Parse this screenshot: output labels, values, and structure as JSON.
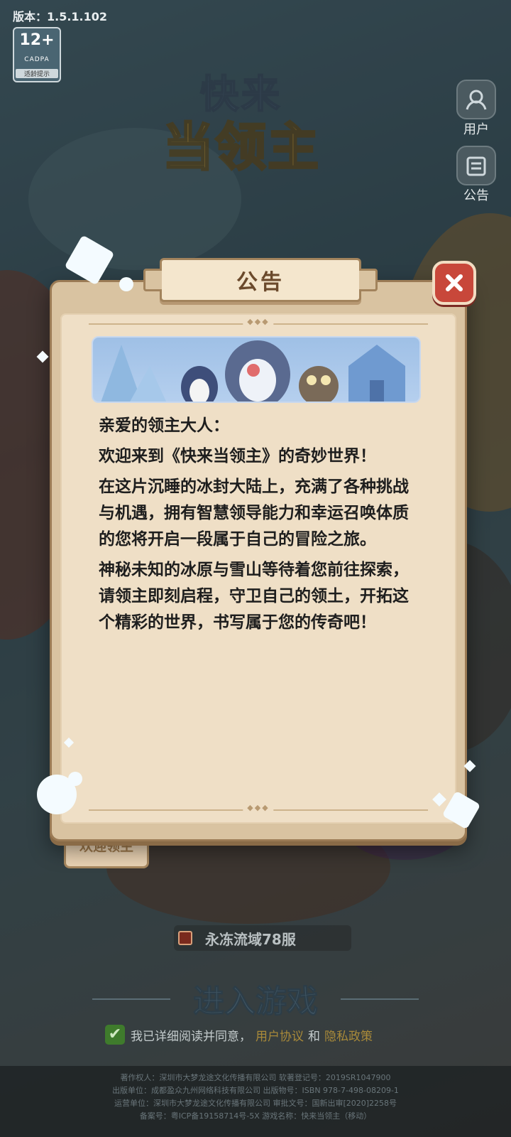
{
  "version_label": "版本：1.5.1.102",
  "age_badge": {
    "age": "12+",
    "org": "CADPA",
    "tip": "适龄提示"
  },
  "logo": {
    "line1": "快来",
    "line2": "当领主"
  },
  "side_buttons": {
    "user_label": "用户",
    "notice_label": "公告"
  },
  "modal": {
    "title": "公告",
    "paragraphs": [
      "亲爱的领主大人：",
      "欢迎来到《快来当领主》的奇妙世界！",
      "在这片沉睡的冰封大陆上，充满了各种挑战与机遇，拥有智慧领导能力和幸运召唤体质的您将开启一段属于自己的冒险之旅。",
      "神秘未知的冰原与雪山等待着您前往探索，请领主即刻启程，守卫自己的领土，开拓这个精彩的世界，书写属于您的传奇吧！"
    ],
    "tab_label": "欢迎领主"
  },
  "server": {
    "name": "永冻流域78服"
  },
  "enter_label": "进入游戏",
  "agreement": {
    "text": "我已详细阅读并同意，",
    "link1": "用户协议",
    "and": "和",
    "link2": "隐私政策"
  },
  "footer": {
    "line1": "著作权人：深圳市大梦龙途文化传播有限公司 软著登记号：2019SR1047900",
    "line2": "出版单位：成都盈众九州网络科技有限公司 出版物号：ISBN 978-7-498-08209-1",
    "line3": "运营单位：深圳市大梦龙途文化传播有限公司 审批文号：国新出审[2020]2258号",
    "line4": "备案号：粤ICP备19158714号-5X 游戏名称：快来当领主（移动）"
  },
  "colors": {
    "modal_bg": "#efdfc6",
    "close_red": "#c8473a",
    "title_brown": "#6b4a2c"
  }
}
